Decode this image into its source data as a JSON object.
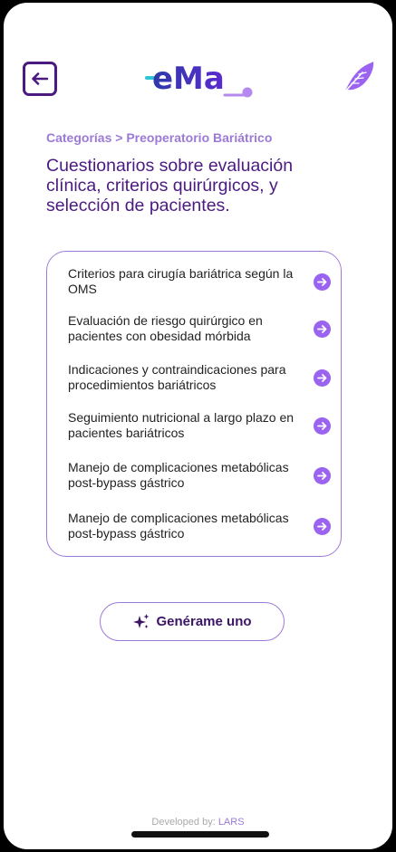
{
  "header": {
    "back_icon": "arrow-left-icon",
    "logo_text": "eMa",
    "feather_icon": "feather-icon"
  },
  "breadcrumb": {
    "root": "Categorías",
    "separator": ">",
    "current": "Preoperatorio Bariátrico"
  },
  "page_title": "Cuestionarios sobre evaluación clínica, criterios quirúrgicos, y selección de pacientes.",
  "topics": [
    {
      "label": "Criterios para cirugía bariátrica según la OMS"
    },
    {
      "label": "Evaluación de riesgo quirúrgico en pacientes con obesidad mórbida"
    },
    {
      "label": "Indicaciones y contraindicaciones para procedimientos bariátricos"
    },
    {
      "label": "Seguimiento nutricional a largo plazo en pacientes bariátricos"
    },
    {
      "label": "Manejo de complicaciones metabólicas post-bypass gástrico"
    },
    {
      "label": "Manejo de complicaciones metabólicas post-bypass gástrico"
    }
  ],
  "generate_button": {
    "label": "Genérame uno",
    "icon": "sparkles-icon"
  },
  "footer": {
    "prefix": "Developed by: ",
    "brand": "LARS"
  },
  "colors": {
    "primary_purple": "#4b1a80",
    "accent_lavender": "#9b7ad6",
    "arrow_button": "#9a63f0",
    "logo_teal": "#2ec4d6",
    "logo_blue": "#2d3aa8"
  }
}
